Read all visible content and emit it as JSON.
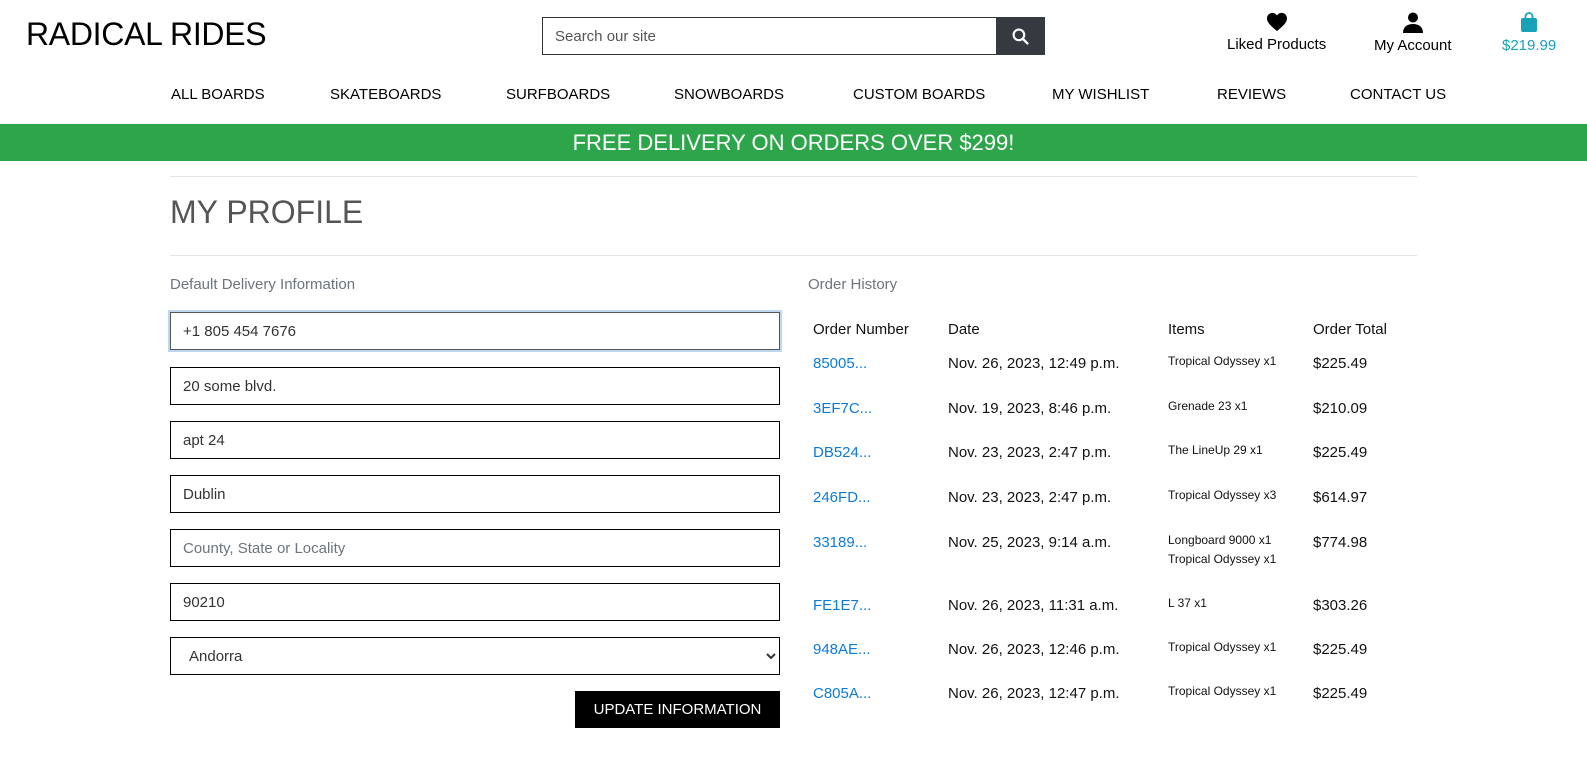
{
  "header": {
    "brand": "RADICAL RIDES",
    "search_placeholder": "Search our site",
    "liked_label": "Liked Products",
    "account_label": "My Account",
    "bag_total": "$219.99",
    "colors": {
      "accent": "#17a2b8",
      "banner": "#2da54a",
      "search_btn": "#343a40",
      "link": "#0d7bd6"
    }
  },
  "nav": [
    "ALL BOARDS",
    "SKATEBOARDS",
    "SURFBOARDS",
    "SNOWBOARDS",
    "CUSTOM BOARDS",
    "MY WISHLIST",
    "REVIEWS",
    "CONTACT US"
  ],
  "banner": "FREE DELIVERY ON ORDERS OVER $299!",
  "page_title": "MY PROFILE",
  "delivery": {
    "section_label": "Default Delivery Information",
    "phone": "+1 805 454 7676",
    "street1": "20 some blvd.",
    "street2": "apt 24",
    "town": "Dublin",
    "county_placeholder": "County, State or Locality",
    "postcode": "90210",
    "country": "Andorra",
    "update_label": "UPDATE INFORMATION"
  },
  "orders": {
    "section_label": "Order History",
    "headers": [
      "Order Number",
      "Date",
      "Items",
      "Order Total"
    ],
    "rows": [
      {
        "number": "85005...",
        "date": "Nov. 26, 2023, 12:49 p.m.",
        "items": [
          "Tropical Odyssey x1"
        ],
        "total": "$225.49"
      },
      {
        "number": "3EF7C...",
        "date": "Nov. 19, 2023, 8:46 p.m.",
        "items": [
          "Grenade 23 x1"
        ],
        "total": "$210.09"
      },
      {
        "number": "DB524...",
        "date": "Nov. 23, 2023, 2:47 p.m.",
        "items": [
          "The LineUp 29 x1"
        ],
        "total": "$225.49"
      },
      {
        "number": "246FD...",
        "date": "Nov. 23, 2023, 2:47 p.m.",
        "items": [
          "Tropical Odyssey x3"
        ],
        "total": "$614.97"
      },
      {
        "number": "33189...",
        "date": "Nov. 25, 2023, 9:14 a.m.",
        "items": [
          "Longboard 9000 x1",
          "Tropical Odyssey x1"
        ],
        "total": "$774.98"
      },
      {
        "number": "FE1E7...",
        "date": "Nov. 26, 2023, 11:31 a.m.",
        "items": [
          "L 37 x1"
        ],
        "total": "$303.26"
      },
      {
        "number": "948AE...",
        "date": "Nov. 26, 2023, 12:46 p.m.",
        "items": [
          "Tropical Odyssey x1"
        ],
        "total": "$225.49"
      },
      {
        "number": "C805A...",
        "date": "Nov. 26, 2023, 12:47 p.m.",
        "items": [
          "Tropical Odyssey x1"
        ],
        "total": "$225.49"
      }
    ]
  }
}
